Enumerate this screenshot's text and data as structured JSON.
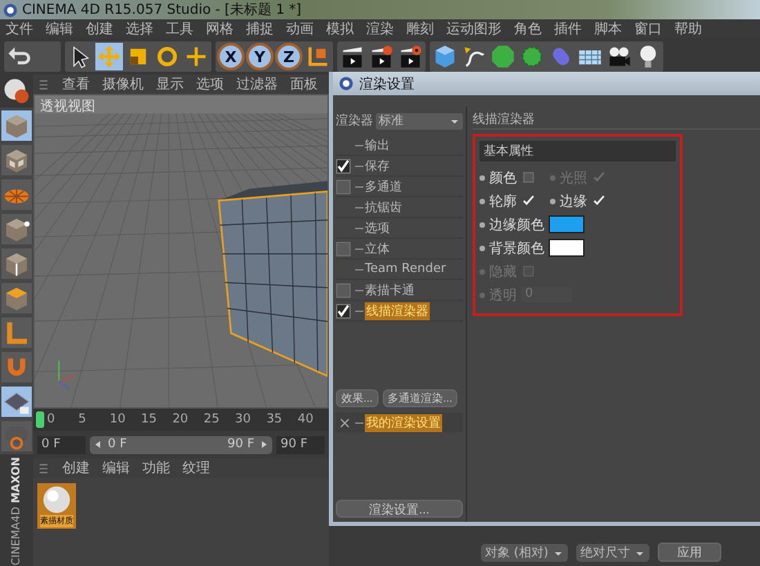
{
  "window": {
    "title": "CINEMA 4D R15.057 Studio - [未标题 1 *]"
  },
  "menu_bar": [
    "文件",
    "编辑",
    "创建",
    "选择",
    "工具",
    "网格",
    "捕捉",
    "动画",
    "模拟",
    "渲染",
    "雕刻",
    "运动图形",
    "角色",
    "插件",
    "脚本",
    "窗口",
    "帮助"
  ],
  "toolbar": {
    "tools": [
      {
        "selected": false
      },
      {
        "selected": true
      },
      {
        "selected": false
      },
      {
        "selected": false
      },
      {
        "selected": false
      }
    ],
    "axis_buttons": [
      {
        "label": "X",
        "selected": true
      },
      {
        "label": "Y",
        "selected": true
      },
      {
        "label": "Z",
        "selected": true
      }
    ]
  },
  "mode_toolbar": [
    {
      "selected": true
    },
    {
      "selected": false
    },
    {
      "selected": false
    },
    {
      "selected": false
    },
    {
      "selected": false
    },
    {
      "selected": false
    },
    {
      "selected": false
    },
    {
      "selected": false
    },
    {
      "selected": true
    },
    {
      "selected": false
    }
  ],
  "logo": {
    "line_1": "MAXON",
    "line_2": "CINEMA4D"
  },
  "viewport": {
    "menu": [
      "查看",
      "摄像机",
      "显示",
      "选项",
      "过滤器",
      "面板"
    ],
    "label": "透视视图"
  },
  "timeline": {
    "ticks": [
      "0",
      "5",
      "10",
      "15",
      "20",
      "25",
      "30",
      "35",
      "40"
    ],
    "start_field": "0 F",
    "range": {
      "start": "0 F",
      "end": "90 F",
      "level": 1
    },
    "end_field": "90 F"
  },
  "material_manager": {
    "menu": [
      "创建",
      "编辑",
      "功能",
      "纹理"
    ],
    "materials": [
      {
        "name": "素描材质",
        "selected": true
      }
    ]
  },
  "render_settings": {
    "title": "渲染设置",
    "renderer_label": "渲染器",
    "renderer": "标准",
    "items": [
      {
        "label": "输出",
        "has_checkbox": false,
        "selected": false
      },
      {
        "label": "保存",
        "has_checkbox": true,
        "checked": true,
        "selected": false
      },
      {
        "label": "多通道",
        "has_checkbox": true,
        "checked": false,
        "selected": false
      },
      {
        "label": "抗锯齿",
        "has_checkbox": false,
        "selected": false
      },
      {
        "label": "选项",
        "has_checkbox": false,
        "selected": false
      },
      {
        "label": "立体",
        "has_checkbox": true,
        "checked": false,
        "selected": false
      },
      {
        "label": "Team Render",
        "has_checkbox": false,
        "selected": false
      },
      {
        "label": "素描卡通",
        "has_checkbox": true,
        "checked": false,
        "selected": false
      },
      {
        "label": "线描渲染器",
        "has_checkbox": true,
        "checked": true,
        "selected": true
      }
    ],
    "buttons": [
      "效果...",
      "多通道渲染..."
    ],
    "presets": [
      {
        "label": "我的渲染设置",
        "selected": true
      }
    ],
    "footer_button": "渲染设置...",
    "panel_title": "线描渲染器",
    "section": "基本属性",
    "rows": [
      [
        {
          "kind": "check",
          "label": "颜色",
          "checked": false,
          "disabled": false
        },
        {
          "kind": "check",
          "label": "光照",
          "checked": true,
          "disabled": true
        }
      ],
      [
        {
          "kind": "check",
          "label": "轮廓",
          "checked": true,
          "disabled": false
        },
        {
          "kind": "check",
          "label": "边缘",
          "checked": true,
          "disabled": false
        }
      ],
      [
        {
          "kind": "color",
          "label": "边缘颜色",
          "color": "#1ea0f0"
        }
      ],
      [
        {
          "kind": "color",
          "label": "背景颜色",
          "color": "#ffffff"
        }
      ],
      [
        {
          "kind": "check",
          "label": "隐藏",
          "checked": false,
          "disabled": true
        }
      ],
      [
        {
          "kind": "number",
          "label": "透明",
          "value": "0",
          "disabled": true
        }
      ]
    ]
  },
  "attributes_bar": {
    "dropdowns": [
      "对象 (相对)",
      "绝对尺寸"
    ],
    "apply": "应用"
  }
}
